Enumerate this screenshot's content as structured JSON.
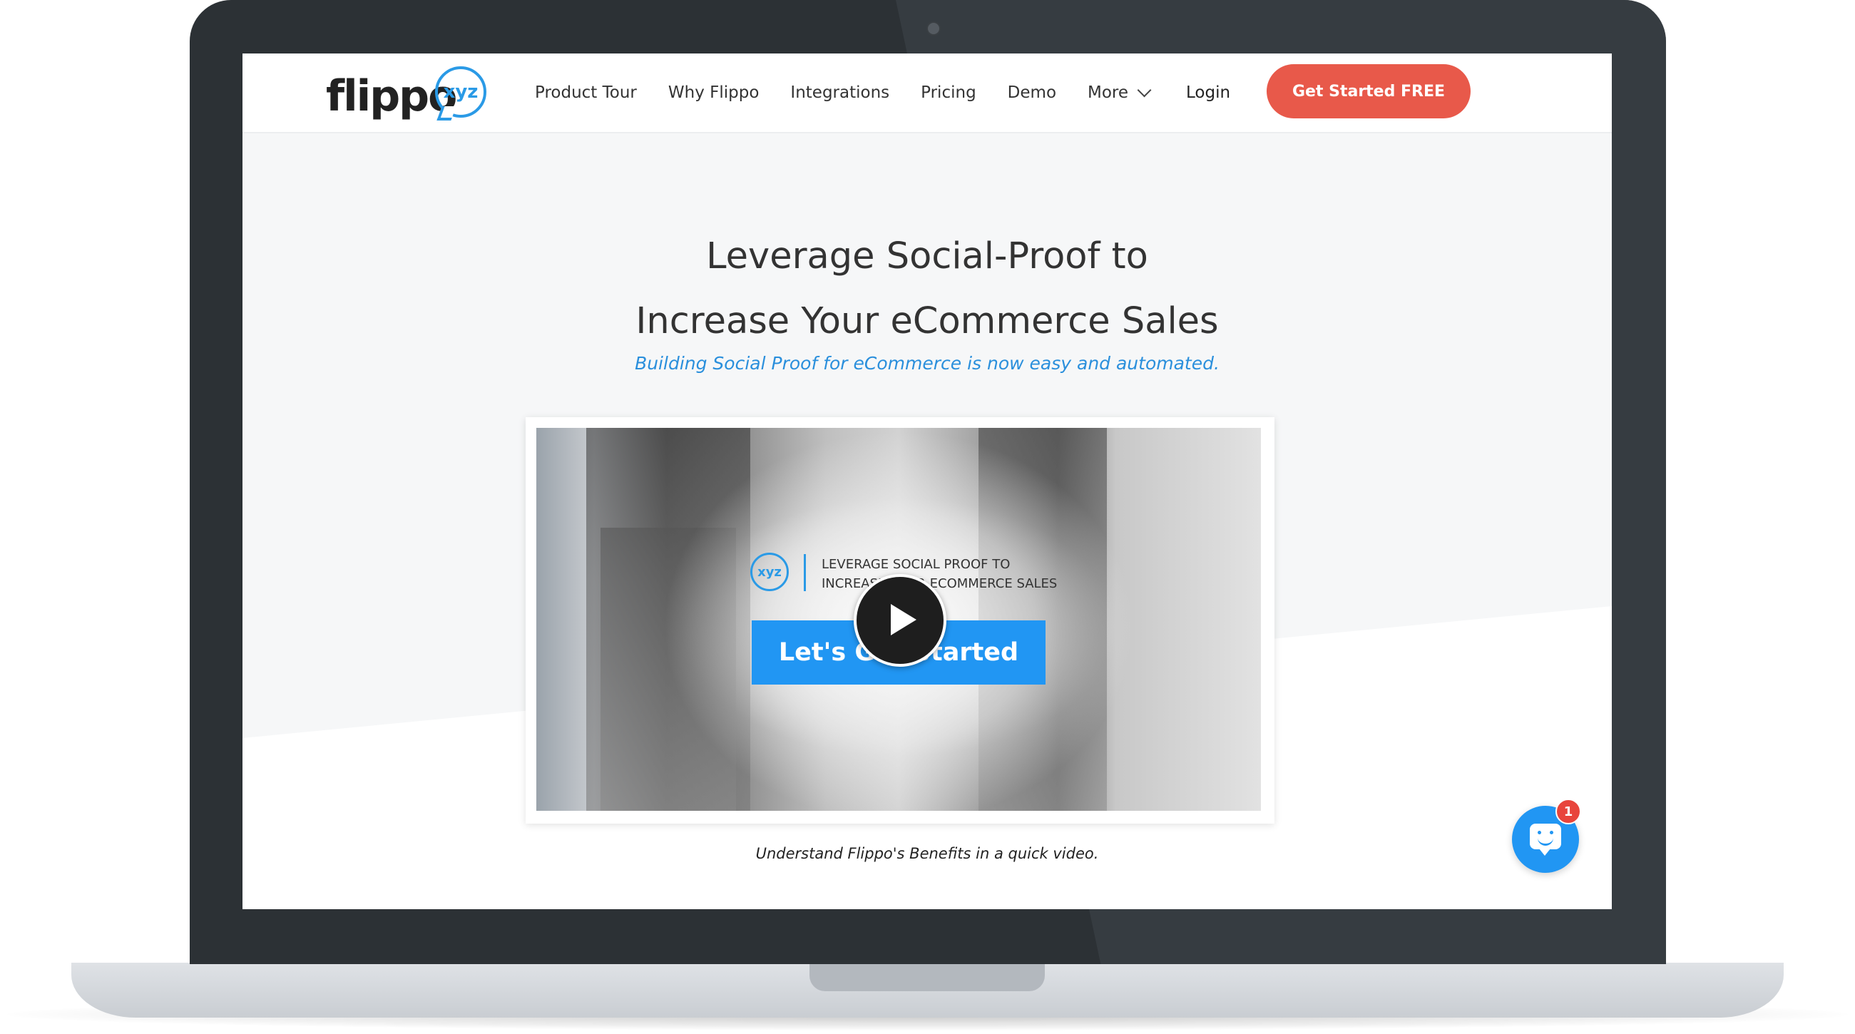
{
  "brand": {
    "logo_text": "flippo",
    "logo_badge": "xyz",
    "accent_color": "#e8594a",
    "primary_blue": "#2196f3"
  },
  "nav": {
    "items": [
      {
        "label": "Product Tour"
      },
      {
        "label": "Why Flippo"
      },
      {
        "label": "Integrations"
      },
      {
        "label": "Pricing"
      },
      {
        "label": "Demo"
      },
      {
        "label": "More"
      }
    ],
    "login": "Login",
    "cta": "Get Started FREE"
  },
  "hero": {
    "title_line1": "Leverage Social-Proof to",
    "title_line2": "Increase Your eCommerce Sales",
    "subtitle": "Building Social Proof for eCommerce is now easy and automated."
  },
  "video": {
    "badge": "xyz",
    "caption_line1": "LEVERAGE SOCIAL PROOF TO",
    "caption_line2": "INCREASE YOUR ECOMMERCE SALES",
    "button_label": "Let's Get Started",
    "note": "Understand Flippo's Benefits in a quick video."
  },
  "chat": {
    "unread_count": "1"
  }
}
